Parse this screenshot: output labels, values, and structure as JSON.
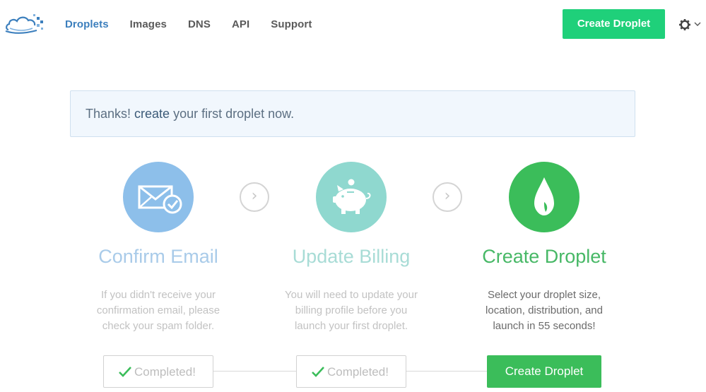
{
  "nav": {
    "items": [
      {
        "label": "Droplets",
        "active": true
      },
      {
        "label": "Images",
        "active": false
      },
      {
        "label": "DNS",
        "active": false
      },
      {
        "label": "API",
        "active": false
      },
      {
        "label": "Support",
        "active": false
      }
    ],
    "create_button": "Create Droplet"
  },
  "banner": {
    "prefix": "Thanks! ",
    "link": "create",
    "suffix": " your first droplet now."
  },
  "steps": [
    {
      "title": "Confirm Email",
      "description": "If you didn't receive your confirmation email, please check your spam folder.",
      "action": "Completed!",
      "icon": "envelope-check-icon",
      "color": "#8dbfea"
    },
    {
      "title": "Update Billing",
      "description": "You will need to update your billing profile before you launch your first droplet.",
      "action": "Completed!",
      "icon": "piggy-bank-icon",
      "color": "#8fd8cf"
    },
    {
      "title": "Create Droplet",
      "description": "Select your droplet size, location, distribution, and launch in 55 seconds!",
      "action": "Create Droplet",
      "icon": "droplet-icon",
      "color": "#3bbd5a"
    }
  ],
  "colors": {
    "accent_green": "#1fd07a",
    "nav_active": "#3c7fbd",
    "step_green": "#3bbd5a"
  }
}
